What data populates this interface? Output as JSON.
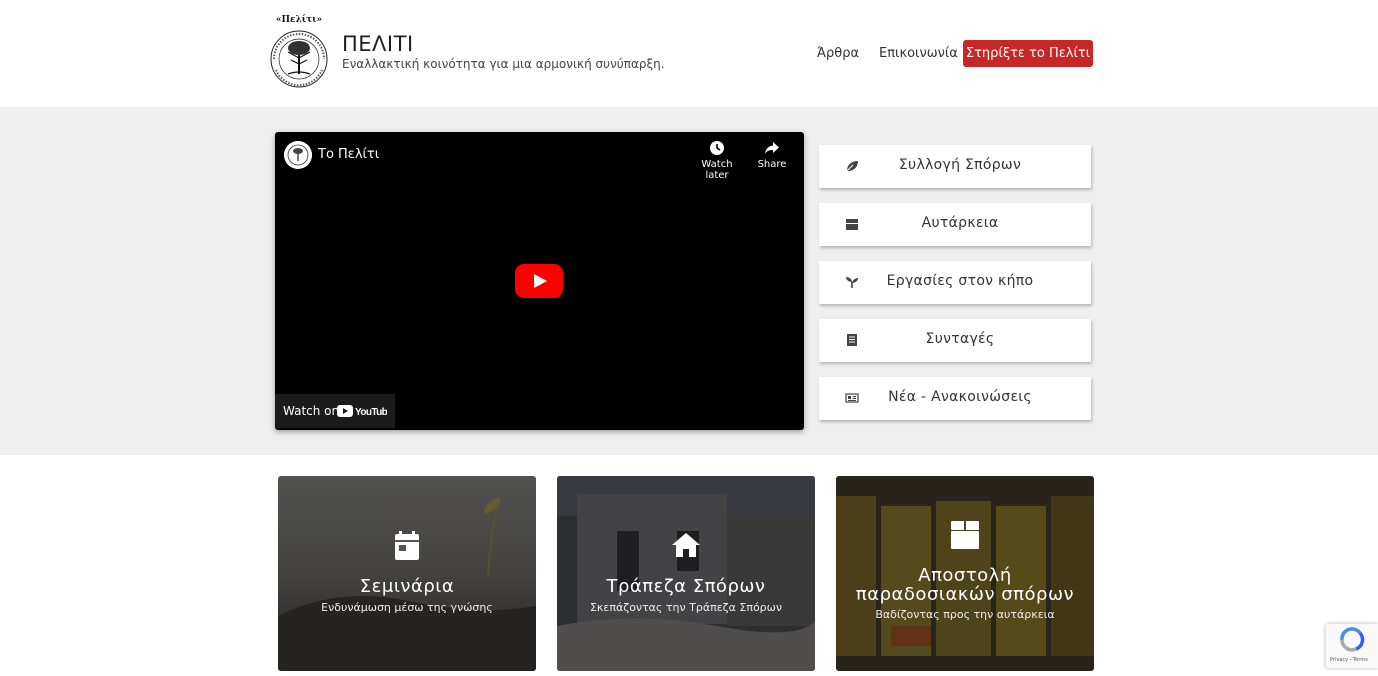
{
  "header": {
    "title": "ΠΕΛΙΤΙ",
    "tagline": "Εναλλακτική κοινότητα για μια αρμονική συνύπαρξη.",
    "logo_text": "«Πελίτι»",
    "nav": {
      "articles": "Άρθρα",
      "contact": "Επικοινωνία",
      "support": "Στηρίξτε το Πελίτι"
    }
  },
  "video": {
    "channel_title": "Το Πελίτι",
    "watch_later": "Watch later",
    "share": "Share",
    "watch_on": "Watch on",
    "youtube": "YouTube"
  },
  "categories": [
    {
      "label": "Συλλογή Σπόρων",
      "icon": "leaf-icon"
    },
    {
      "label": "Αυτάρκεια",
      "icon": "box-icon"
    },
    {
      "label": "Εργασίες στον κήπο",
      "icon": "seedling-icon"
    },
    {
      "label": "Συνταγές",
      "icon": "notebook-icon"
    },
    {
      "label": "Νέα - Ανακοινώσεις",
      "icon": "newspaper-icon"
    }
  ],
  "cards": [
    {
      "title": "Σεμινάρια",
      "subtitle": "Ενδυνάμωση μέσω της γνώσης",
      "icon": "calendar-icon"
    },
    {
      "title": "Τράπεζα Σπόρων",
      "subtitle": "Σκεπάζοντας την Τράπεζα Σπόρων",
      "icon": "home-icon"
    },
    {
      "title_line1": "Αποστολή",
      "title_line2": "παραδοσιακών σπόρων",
      "subtitle": "Βαδίζοντας προς την αυτάρκεια",
      "icon": "box-icon"
    }
  ],
  "recaptcha": {
    "text": "Privacy - Terms"
  },
  "colors": {
    "accent": "#c62828",
    "band": "#efefef",
    "youtube_red": "#ff0000"
  }
}
